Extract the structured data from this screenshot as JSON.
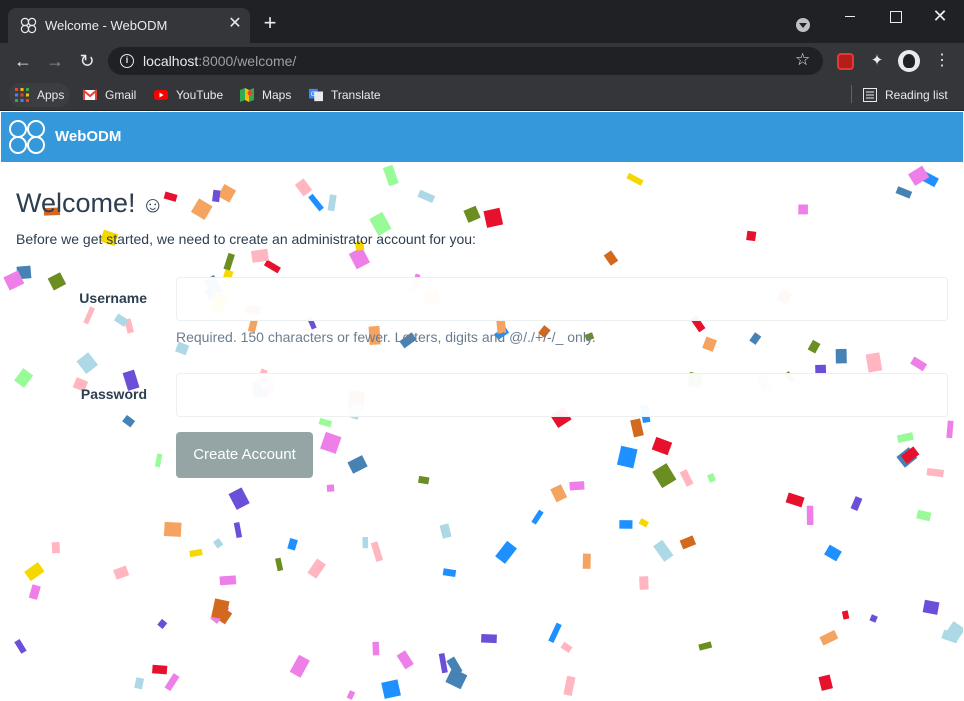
{
  "browser": {
    "tab_title": "Welcome - WebODM",
    "tab_close": "✕",
    "new_tab": "+",
    "url_host": "localhost",
    "url_path": ":8000/welcome/",
    "back": "←",
    "forward": "→",
    "reload": "↻",
    "star": "☆",
    "menu": "⋮",
    "window_close": "✕",
    "bookmarks": {
      "apps": "Apps",
      "gmail": "Gmail",
      "youtube": "YouTube",
      "maps": "Maps",
      "translate": "Translate",
      "reading_list": "Reading list"
    }
  },
  "app": {
    "brand": "WebODM",
    "accent_color": "#3498db",
    "welcome_title": "Welcome!",
    "smiley": "☺",
    "intro_text": "Before we get started, we need to create an administrator account for you:",
    "username_label": "Username",
    "password_label": "Password",
    "username_value": "",
    "password_value": "",
    "username_help": "Required. 150 characters or fewer. Letters, digits and @/./+/-/_ only.",
    "create_button": "Create Account"
  },
  "confetti_colors": [
    "#f4d800",
    "#e8112d",
    "#6b4fd8",
    "#ee7fe8",
    "#98fb98",
    "#4682b4",
    "#ffb6c1",
    "#add8e6",
    "#6b8e23",
    "#1e90ff",
    "#d2691e",
    "#f4a460"
  ]
}
